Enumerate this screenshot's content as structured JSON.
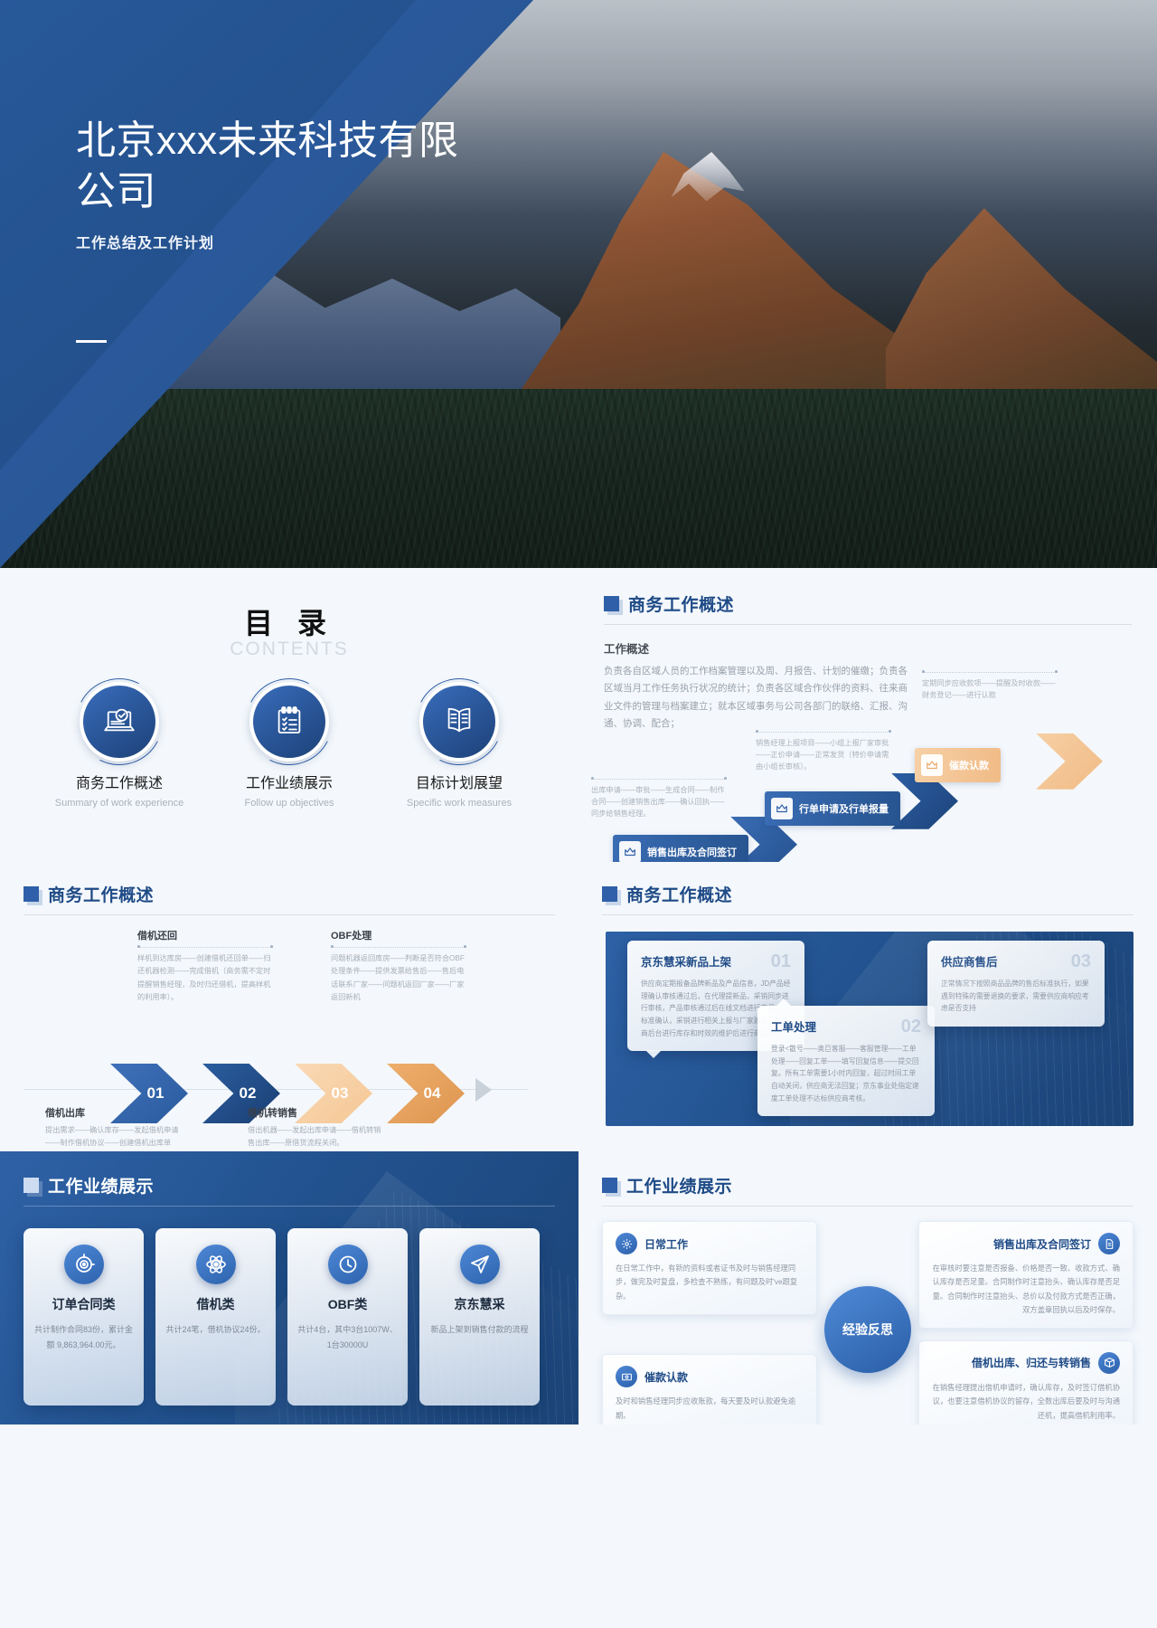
{
  "hero": {
    "title": "北京xxx未来科技有限公司",
    "subtitle": "工作总结及工作计划"
  },
  "toc": {
    "title_cn": "目 录",
    "title_en": "CONTENTS",
    "items": [
      {
        "icon": "laptop-check-icon",
        "label": "商务工作概述",
        "sub": "Summary of work experience"
      },
      {
        "icon": "checklist-icon",
        "label": "工作业绩展示",
        "sub": "Follow up objectives"
      },
      {
        "icon": "open-book-icon",
        "label": "目标计划展望",
        "sub": "Specific work measures"
      }
    ]
  },
  "overview": {
    "heading": "商务工作概述",
    "sub_heading": "工作概述",
    "paragraph": "负责各自区域人员的工作档案管理以及周、月报告、计划的催缴；负责各区域当月工作任务执行状况的统计；负责各区域合作伙伴的资料、往来商业文件的管理与档案建立；就本区域事务与公司各部门的联络、汇报、沟通、协调、配合；",
    "flow": [
      {
        "tag": "销售出库及合同签订",
        "icon": "crown-icon",
        "style": "blue"
      },
      {
        "tag": "行单申请及行单报量",
        "icon": "crown-icon",
        "style": "blue"
      },
      {
        "tag": "催款认款",
        "icon": "crown-icon",
        "style": "orange"
      }
    ],
    "notes": [
      {
        "text": "出库申请——审批——生成合同——制作合同——创建销售出库——确认回执——同步给销售经理。"
      },
      {
        "text": "销售经理上报项目——小组上报厂家审批——正价申请——正常发货（特价申请需由小组长审核）。"
      },
      {
        "text": "定期同步应收款项——提醒及时收款——财务登记——进行认款"
      }
    ]
  },
  "steps": {
    "heading": "商务工作概述",
    "items": [
      {
        "num": "01",
        "title": "借机出库",
        "body": "提出需求——确认库存——发起借机申请——制作借机协议——创建借机出库单——销售经理同步",
        "pos": "bottom"
      },
      {
        "num": "02",
        "title": "借机还回",
        "body": "样机到达库房——创建借机还回单——归还机器检测——完成借机（商务需不定时提醒销售经理，及时归还借机，提高样机的利用率）。",
        "pos": "top"
      },
      {
        "num": "03",
        "title": "借机转销售",
        "body": "借出机器——发起出库申请——借机转销售出库——原借货流程关闭。",
        "pos": "bottom"
      },
      {
        "num": "04",
        "title": "OBF处理",
        "body": "问题机器返回库房——判断是否符合OBF处理条件——提供发票给售后——售后电话联系厂家——问题机返回厂家——厂家返回新机",
        "pos": "top"
      }
    ]
  },
  "bubbles": {
    "heading": "商务工作概述",
    "items": [
      {
        "num": "01",
        "title": "京东慧采新品上架",
        "body": "供应商定期报备品牌新品及产品信息，JD产品经理确认审核通过后，在代理提新品，采销同步进行审核，产品审核通过后在线文档进行产品上下标准确认，采销进行相关上报与厂家建立，供应商后台进行库存和时效的维护后进行商品展示"
      },
      {
        "num": "02",
        "title": "工单处理",
        "body": "登录<散号——奥巨客服——客服管理——工单处理——回复工单——填写回复信息——提交回复。所有工单需要1小时内回复，超过时间工单自动关闭，供应商无法回复；京东事业处指定速度工单处理不达标供应商考核。"
      },
      {
        "num": "03",
        "title": "供应商售后",
        "body": "正常情况下按照商品品牌的售后标准执行，如果遇到特殊的需要退换的要求，需要供应商响应考虑是否支持"
      }
    ]
  },
  "performance": {
    "heading": "工作业绩展示",
    "cards": [
      {
        "icon": "target-icon",
        "title": "订单合同类",
        "body": "共计制作合同83份，累计金额 9,863,964.00元。"
      },
      {
        "icon": "atom-icon",
        "title": "借机类",
        "body": "共计24笔，借机协议24份。"
      },
      {
        "icon": "clock-icon",
        "title": "OBF类",
        "body": "共计4台，其中3台1007W、1台30000U"
      },
      {
        "icon": "send-icon",
        "title": "京东慧采",
        "body": "新品上架到销售付款的流程"
      }
    ]
  },
  "reflection": {
    "heading": "工作业绩展示",
    "center": "经验反思",
    "items": [
      {
        "icon": "gear-icon",
        "title": "日常工作",
        "body": "在日常工作中，有新的资料或者证书及时与销售经理同步，做完及时复盘，多检查不熟练，有问题及时've跟复杂。",
        "align": "left",
        "row": "top"
      },
      {
        "icon": "doc-icon",
        "title": "销售出库及合同签订",
        "body": "在审核时要注意是否报备、价格是否一致、收款方式、确认库存是否足量。合同制作时注意抬头、确认库存是否足量。合同制作时注意抬头、总价以及付款方式是否正确，双方盖章回执以后及时保存。",
        "align": "right",
        "row": "top"
      },
      {
        "icon": "money-icon",
        "title": "催款认款",
        "body": "及时和销售经理同步应收账款，每天要及时认款避免逾期。",
        "align": "left",
        "row": "bottom"
      },
      {
        "icon": "box-icon",
        "title": "借机出库、归还与转销售",
        "body": "在销售经理提出借机申请时，确认库存，及时签订借机协议，也要注意借机协议的留存，全数出库后要及时与沟通还机，提高借机利用率。",
        "align": "right",
        "row": "bottom"
      }
    ]
  }
}
